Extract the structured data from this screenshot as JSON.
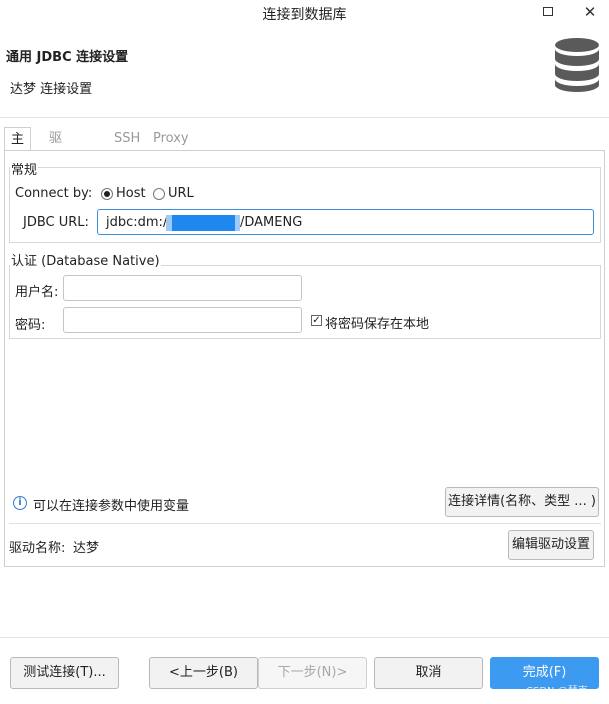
{
  "window": {
    "title": "连接到数据库",
    "maximize_icon": "maximize-icon",
    "close_glyph": "✕"
  },
  "header": {
    "title": "通用 JDBC 连接设置",
    "subtitle": "达梦 连接设置",
    "icon": "database-icon"
  },
  "tabs": [
    {
      "label": "主要",
      "active": true
    },
    {
      "label": "驱动属性",
      "active": false
    },
    {
      "label": "SSH",
      "active": false
    },
    {
      "label": "Proxy",
      "active": false
    }
  ],
  "general": {
    "group_label": "常规",
    "connect_by_label": "Connect by:",
    "options": [
      {
        "label": "Host",
        "checked": true
      },
      {
        "label": "URL",
        "checked": false
      }
    ],
    "jdbc_url_label": "JDBC URL:",
    "jdbc_url_prefix": "jdbc:dm://",
    "jdbc_url_suffix": "/DAMENG"
  },
  "auth": {
    "group_label": "认证 (Database Native)",
    "username_label": "用户名:",
    "username_value": "",
    "password_label": "密码:",
    "password_value": "",
    "save_password_label": "将密码保存在本地",
    "save_password_checked": true
  },
  "info": {
    "text": "可以在连接参数中使用变量",
    "details_button": "连接详情(名称、类型 ... )"
  },
  "driver": {
    "label": "驱动名称:",
    "value": "达梦",
    "edit_button": "编辑驱动设置"
  },
  "footer": {
    "test_button": "测试连接(T)...",
    "back_button": "<上一步(B)",
    "next_button": "下一步(N)>",
    "cancel_button": "取消",
    "finish_button": "完成(F)"
  },
  "watermark": "CSDN @慧克",
  "colors": {
    "accent": "#3c9bf0",
    "info": "#2f7fd0",
    "redaction": "#1e88f0"
  }
}
